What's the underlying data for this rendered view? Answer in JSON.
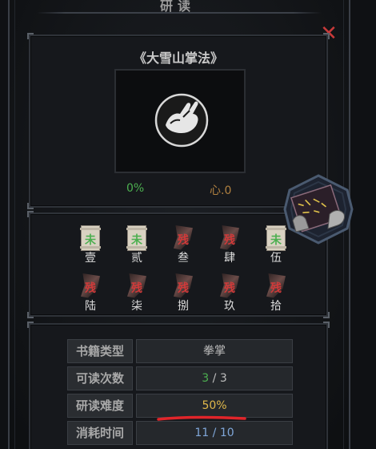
{
  "header": {
    "title": "研读"
  },
  "book": {
    "title": "《大雪山掌法》",
    "progress": "0%",
    "heart": "心.0"
  },
  "chapters": [
    {
      "label": "壹",
      "state": "good",
      "mark": "未"
    },
    {
      "label": "贰",
      "state": "good",
      "mark": "未"
    },
    {
      "label": "叁",
      "state": "torn",
      "mark": "残"
    },
    {
      "label": "肆",
      "state": "torn",
      "mark": "残"
    },
    {
      "label": "伍",
      "state": "good",
      "mark": "未"
    },
    {
      "label": "陆",
      "state": "torn",
      "mark": "残"
    },
    {
      "label": "柒",
      "state": "torn",
      "mark": "残"
    },
    {
      "label": "捌",
      "state": "torn",
      "mark": "残"
    },
    {
      "label": "玖",
      "state": "torn",
      "mark": "残"
    },
    {
      "label": "拾",
      "state": "torn",
      "mark": "残"
    }
  ],
  "info": {
    "type_label": "书籍类型",
    "type_value": "拳掌",
    "reads_label": "可读次数",
    "reads_current": "3",
    "reads_sep": " / ",
    "reads_total": "3",
    "difficulty_label": "研读难度",
    "difficulty_value": "50%",
    "time_label": "消耗时间",
    "time_current": "11",
    "time_sep": " / ",
    "time_total": "10"
  },
  "colors": {
    "good": "#4caf50",
    "torn": "#d23a3a",
    "gold": "#e0b84a",
    "blue": "#7fa6d8",
    "close": "#c83a3a"
  },
  "icons": {
    "close": "close-x-icon",
    "technique": "palm-technique-icon",
    "medallion": "hand-holding-scroll-icon"
  }
}
